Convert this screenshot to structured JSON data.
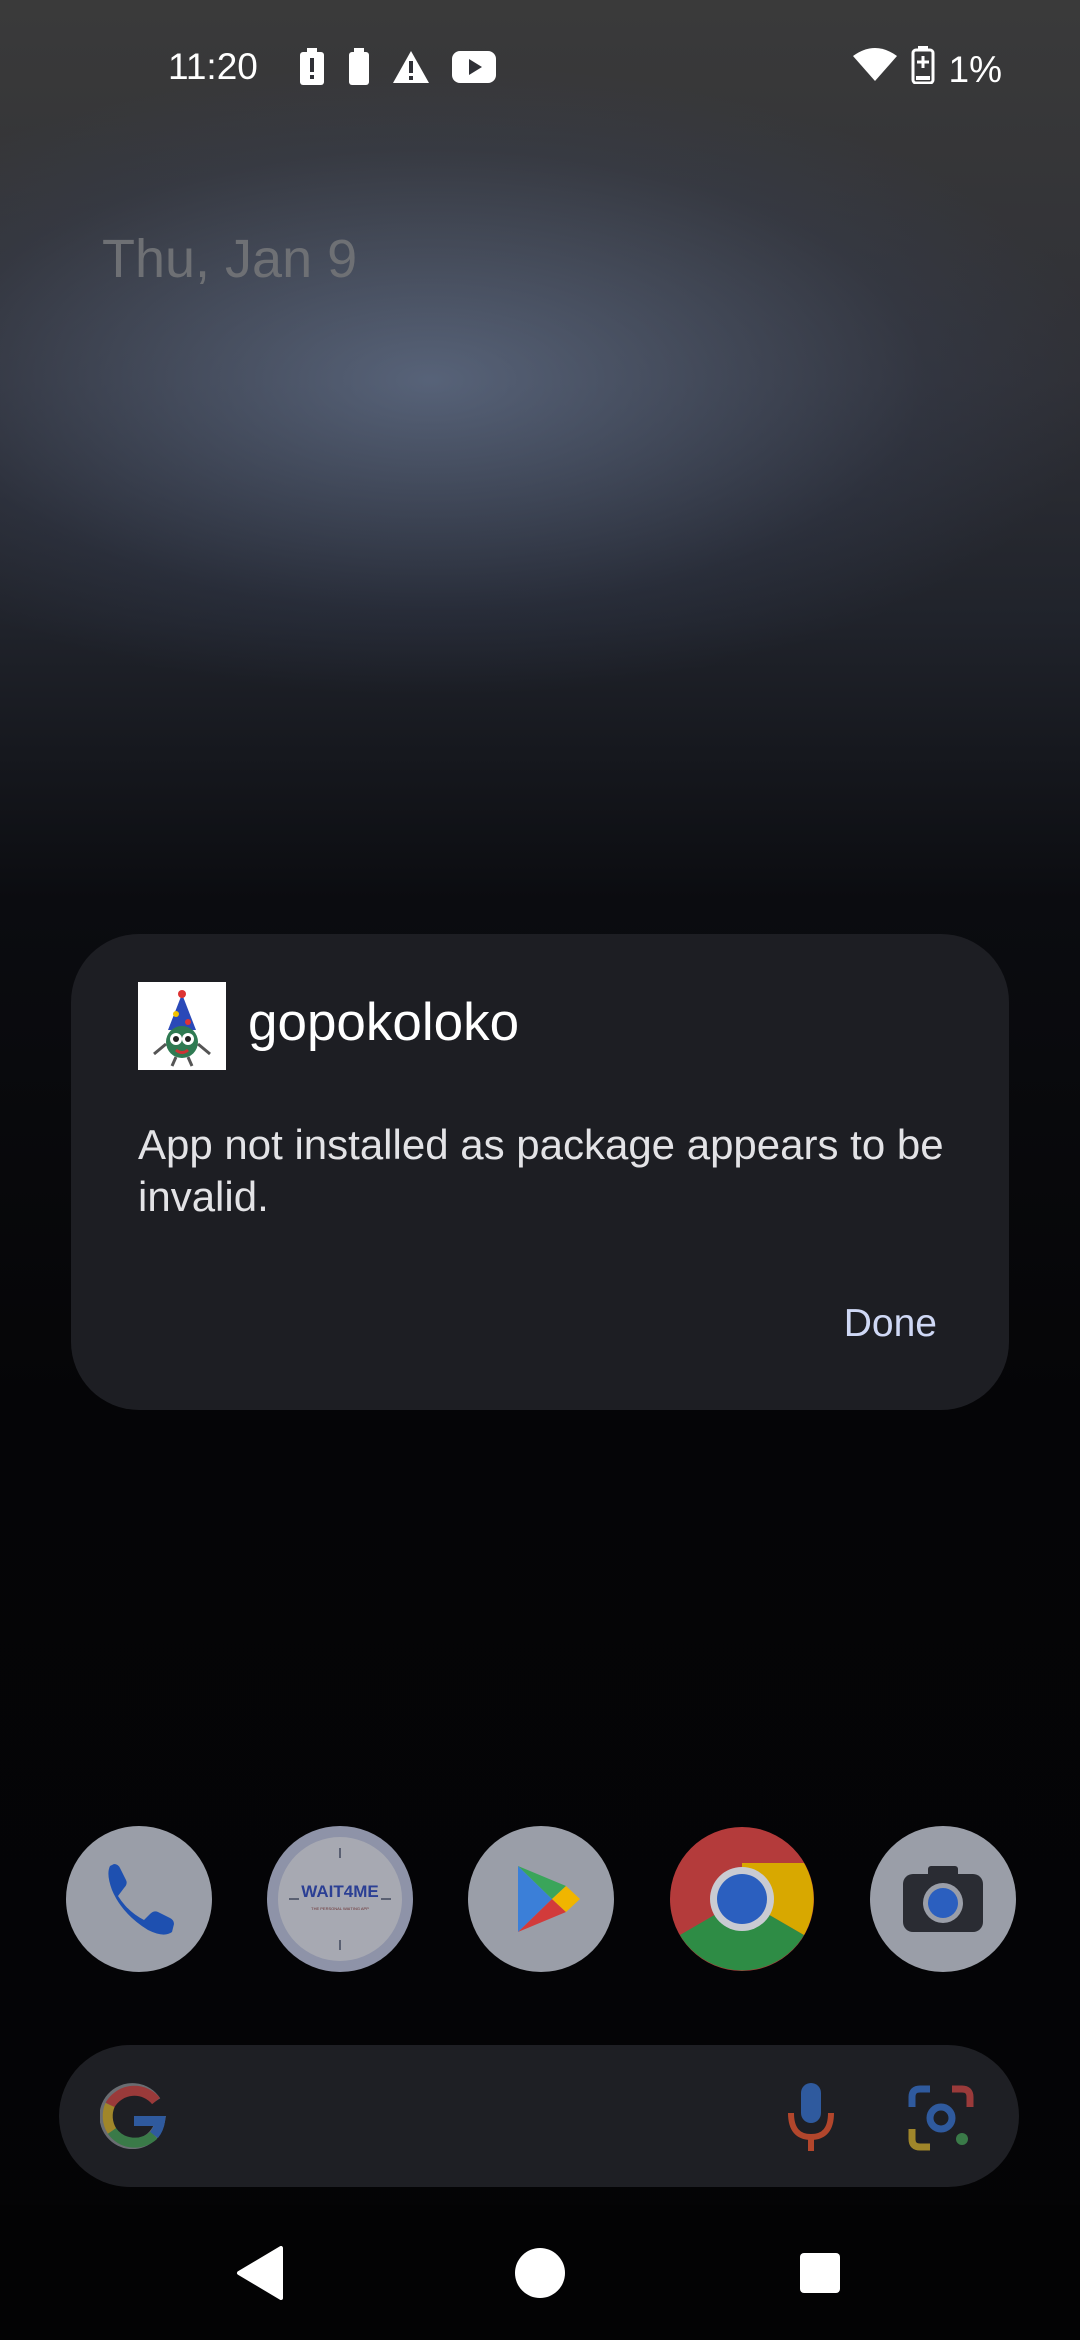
{
  "status_bar": {
    "time": "11:20",
    "battery_level": "1%",
    "left_icons": [
      "battery-alert-icon",
      "battery-icon",
      "warning-icon",
      "youtube-icon"
    ],
    "right_icons": [
      "wifi-icon",
      "battery-charging-icon"
    ]
  },
  "home": {
    "date": "Thu, Jan 9"
  },
  "dialog": {
    "app_name": "gopokoloko",
    "message": "App not installed as package appears to be invalid.",
    "done_label": "Done"
  },
  "dock": {
    "apps": [
      {
        "name": "Phone",
        "icon": "phone-icon"
      },
      {
        "name": "Wait4Me",
        "icon_text": "WAIT4ME",
        "subtitle": "THE PERSONAL WAITING APP"
      },
      {
        "name": "Play Store",
        "icon": "play-store-icon"
      },
      {
        "name": "Chrome",
        "icon": "chrome-icon"
      },
      {
        "name": "Camera",
        "icon": "camera-icon"
      }
    ]
  },
  "search_bar": {
    "icons": [
      "google-g-icon",
      "mic-icon",
      "lens-icon"
    ]
  },
  "nav_bar": {
    "buttons": [
      "back-icon",
      "home-icon",
      "recents-icon"
    ]
  },
  "colors": {
    "dialog_bg": "#1d1e23",
    "done_text": "#cfd8f5",
    "search_bg": "#1e1f24"
  }
}
